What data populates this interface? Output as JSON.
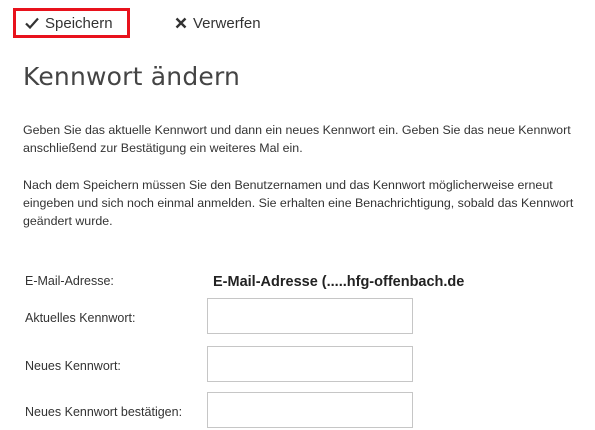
{
  "toolbar": {
    "save_label": "Speichern",
    "discard_label": "Verwerfen"
  },
  "page_title": "Kennwort ändern",
  "paragraphs": [
    "Geben Sie das aktuelle Kennwort und dann ein neues Kennwort ein. Geben Sie das neue Kennwort anschließend zur Bestätigung ein weiteres Mal ein.",
    "Nach dem Speichern müssen Sie den Benutzernamen und das Kennwort möglicherweise erneut eingeben und sich noch einmal anmelden. Sie erhalten eine Benachrichtigung, sobald das Kennwort geändert wurde."
  ],
  "form": {
    "email_label": "E-Mail-Adresse:",
    "email_value": "E-Mail-Adresse (.....hfg-offenbach.de",
    "current_password_label": "Aktuelles Kennwort:",
    "current_password_value": "",
    "new_password_label": "Neues Kennwort:",
    "new_password_value": "",
    "confirm_password_label": "Neues Kennwort bestätigen:",
    "confirm_password_value": ""
  },
  "colors": {
    "highlight": "#e8121c"
  }
}
